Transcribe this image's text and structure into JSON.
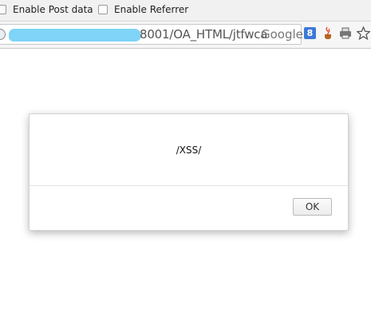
{
  "toolbar": {
    "post_data_label": "Enable Post data",
    "referrer_label": "Enable Referrer"
  },
  "address_bar": {
    "url_visible": "8001/OA_HTML/jtfwca",
    "search_hint": "Google",
    "search_engine_icon": "google-8-icon",
    "extension_icons": [
      "java-cup-icon",
      "printer-icon",
      "star-icon"
    ]
  },
  "dialog": {
    "message": "/XSS/",
    "ok_label": "OK"
  }
}
